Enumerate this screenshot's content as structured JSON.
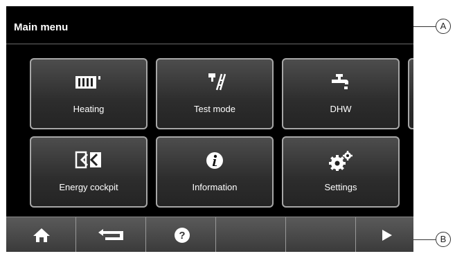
{
  "window": {
    "title": "Main menu"
  },
  "tiles": [
    {
      "label": "Heating",
      "icon": "radiator-icon"
    },
    {
      "label": "Test mode",
      "icon": "wrench-ladder-icon"
    },
    {
      "label": "DHW",
      "icon": "faucet-icon"
    },
    {
      "label": "Energy cockpit",
      "icon": "energy-cockpit-icon"
    },
    {
      "label": "Information",
      "icon": "info-icon"
    },
    {
      "label": "Settings",
      "icon": "gears-icon"
    }
  ],
  "bottom_bar": {
    "buttons": [
      {
        "icon": "home-icon"
      },
      {
        "icon": "back-arrow-icon"
      },
      {
        "icon": "help-icon"
      },
      {
        "icon": ""
      },
      {
        "icon": ""
      },
      {
        "icon": "play-next-icon"
      }
    ]
  },
  "callouts": {
    "a": "A",
    "b": "B"
  }
}
